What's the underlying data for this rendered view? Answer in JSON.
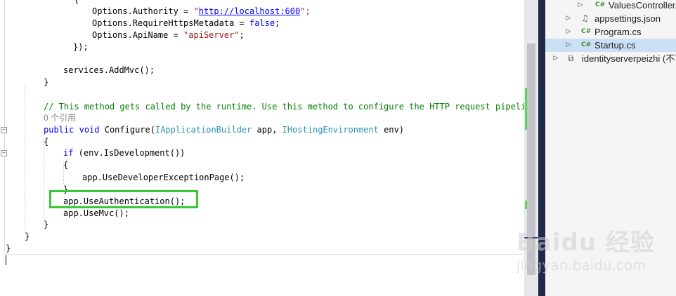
{
  "editor": {
    "lines": {
      "l0": "{",
      "l1_a": "Options.Authority = ",
      "l1_q1": "\"",
      "l1_url": "http://localhost:600",
      "l1_q2": "\";",
      "l2_a": "Options.RequireHttpsMetadata = ",
      "l2_kw": "false",
      "l2_b": ";",
      "l3_a": "Options.ApiName = ",
      "l3_str": "\"apiServer\"",
      "l3_b": ";",
      "l4": "});",
      "l5": "services.AddMvc();",
      "l6": "}",
      "l7": "// This method gets called by the runtime. Use this method to configure the HTTP request pipeline.",
      "l8": "0 个引用",
      "l9_kw1": "public",
      "l9_kw2": "void",
      "l9_name": "Configure(",
      "l9_t1": "IApplicationBuilder",
      "l9_p1": " app, ",
      "l9_t2": "IHostingEnvironment",
      "l9_p2": " env)",
      "l10": "{",
      "l11_kw": "if",
      "l11_rest": " (env.IsDevelopment())",
      "l12": "{",
      "l13": "app.UseDeveloperExceptionPage();",
      "l14": "}",
      "l15": "app.UseAuthentication();",
      "l16": "app.UseMvc();",
      "l17": "}",
      "l18": "}",
      "l19": "}"
    },
    "fold_symbol": "−",
    "highlight_color": "#33cc33"
  },
  "solution_explorer": {
    "items": [
      {
        "label": "ValuesController.",
        "icon": "C#",
        "arrow": "▷"
      },
      {
        "label": "appsettings.json",
        "icon": "json-file-icon",
        "arrow": "▷"
      },
      {
        "label": "Program.cs",
        "icon": "C#",
        "arrow": "▷"
      },
      {
        "label": "Startup.cs",
        "icon": "C#",
        "arrow": "▷"
      },
      {
        "label": "identityserverpeizhi (不可",
        "icon": "project-icon",
        "arrow": "▷"
      }
    ],
    "selected_index": 3
  },
  "watermark": {
    "brand": "Baidu 经验",
    "url": "jingyan.baidu.com"
  },
  "colors": {
    "keyword": "#0000ff",
    "string": "#a31515",
    "comment": "#008000",
    "type": "#2b91af",
    "scroll_change_marker": "#57d857",
    "splitter": "#1e2a4a"
  }
}
